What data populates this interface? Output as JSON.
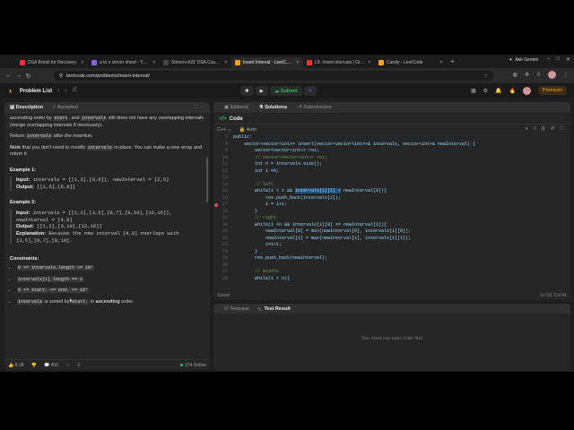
{
  "browser": {
    "tabs": [
      {
        "title": "DSA Break for Recovery",
        "color": "#e33"
      },
      {
        "title": "a to z striver sheet - YouTube",
        "color": "#8b5cf6"
      },
      {
        "title": "Strivers A2Z DSA Course",
        "color": "#444"
      },
      {
        "title": "Insert Interval - LeetCode",
        "color": "#ffa116"
      },
      {
        "title": "L9. Insert Intervals | Greedy",
        "color": "#e33"
      },
      {
        "title": "Candy - LeetCode",
        "color": "#ffa116"
      }
    ],
    "active_tab": 3,
    "ask_gemini": "Ask Gemini",
    "url": "leetcode.com/problems/insert-interval/"
  },
  "header": {
    "problem_list": "Problem List",
    "run": "▶",
    "submit": "Submit",
    "premium": "Premium"
  },
  "left_tabs": {
    "description": "Description",
    "accepted": "Accepted"
  },
  "description": {
    "p1_a": "ascending order by ",
    "p1_code1": "start",
    "p1_b": ", and ",
    "p1_code2": "intervals",
    "p1_c": " still does not have any overlapping intervals (merge overlapping intervals if necessary).",
    "p2_a": "Return ",
    "p2_code": "intervals",
    "p2_b": " after the insertion.",
    "p3_bold": "Note",
    "p3_a": " that you don't need to modify ",
    "p3_code": "intervals",
    "p3_b": " in-place. You can make a new array and return it.",
    "ex1_title": "Example 1:",
    "ex1_input": "intervals = [[1,3],[6,9]], newInterval = [2,5]",
    "ex1_output": "[[1,5],[6,9]]",
    "ex2_title": "Example 2:",
    "ex2_input": "intervals = [[1,2],[3,5],[6,7],[8,10],[12,16]],",
    "ex2_input2": "newInterval = [4,8]",
    "ex2_output": "[[1,2],[3,10],[12,16]]",
    "ex2_expl": "Because the new interval [4,8] overlaps with",
    "ex2_expl2": "[3,5],[6,7],[8,10].",
    "constraints_title": "Constraints:",
    "c1": "0 <= intervals.length <= 10⁴",
    "c2": "intervals[i].length == 2",
    "c3": "0 <= startᵢ <= endᵢ <= 10⁵",
    "c4_code1": "intervals",
    "c4_a": " is sorted by ",
    "c4_code2": "startᵢ",
    "c4_b": " in ",
    "c4_bold": "ascending",
    "c4_c": " order."
  },
  "left_footer": {
    "likes": "9.1K",
    "comments": "451",
    "online": "174 Online"
  },
  "right_tabs": {
    "editorial": "Editorial",
    "solutions": "Solutions",
    "submissions": "Submissions"
  },
  "code_panel": {
    "title": "Code",
    "lang": "C++",
    "mode": "Auto",
    "saved": "Saved",
    "position": "Ln 19, Col 41",
    "lines": [
      {
        "n": "7",
        "t": "public:"
      },
      {
        "n": "8",
        "t": "    vector<vector<int>> insert(vector<vector<int>>& intervals, vector<int>& newInterval) {"
      },
      {
        "n": "9",
        "t": "        vector<vector<int>> res;"
      },
      {
        "n": "10",
        "t": "        // vector<vector<int>> res;"
      },
      {
        "n": "11",
        "t": "        int n = intervals.size();"
      },
      {
        "n": "12",
        "t": "        int i =0;"
      },
      {
        "n": "13",
        "t": ""
      },
      {
        "n": "14",
        "t": "        // left"
      },
      {
        "n": "15",
        "t": "        while(i < n && intervals[i][1] < newInterval[0]){"
      },
      {
        "n": "16",
        "t": "            res.push_back(intervals[i]);"
      },
      {
        "n": "17",
        "t": "            i = i+1;"
      },
      {
        "n": "18",
        "t": "        }"
      },
      {
        "n": "19",
        "t": "        // right"
      },
      {
        "n": "20",
        "t": "        while(i <n && intervals[i][0] <= newInterval[1]){"
      },
      {
        "n": "21",
        "t": "            newInterval[0] = min(newInterval[0], intervals[i][0]);"
      },
      {
        "n": "22",
        "t": "            newInterval[1] = max(newInterval[1], intervals[i][1]);"
      },
      {
        "n": "23",
        "t": "            i=i+1;"
      },
      {
        "n": "24",
        "t": "        }"
      },
      {
        "n": "25",
        "t": "        res.push_back(newInterval);"
      },
      {
        "n": "26",
        "t": ""
      },
      {
        "n": "27",
        "t": "        // middle"
      },
      {
        "n": "28",
        "t": "        while(i < n){"
      }
    ]
  },
  "test_panel": {
    "testcase": "Testcase",
    "result": "Test Result",
    "message": "You must run your code first"
  }
}
